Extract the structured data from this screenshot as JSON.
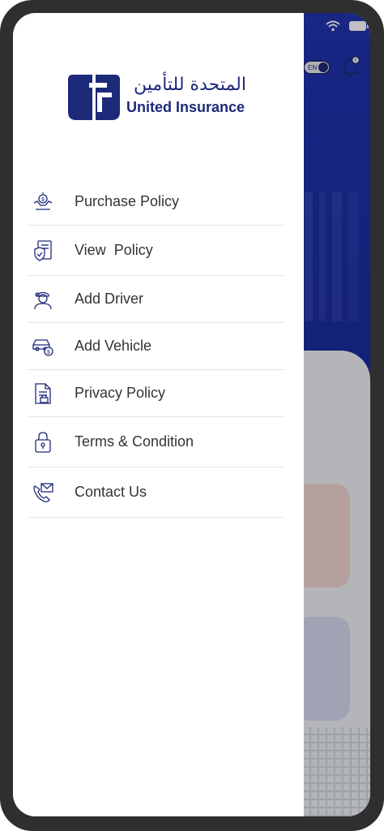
{
  "brand": {
    "name_ar": "المتحدة للتأمين",
    "name_en": "United Insurance",
    "color": "#1d2a7a"
  },
  "status_bar": {
    "icons": [
      "wifi-icon",
      "battery-icon"
    ]
  },
  "background": {
    "language_toggle": "EN",
    "header_color": "#1f32aa"
  },
  "drawer": {
    "items": [
      {
        "label": "Purchase Policy",
        "icon": "money-hand-icon"
      },
      {
        "label": "View  Policy",
        "icon": "policy-document-icon"
      },
      {
        "label": "Add Driver",
        "icon": "driver-icon"
      },
      {
        "label": "Add Vehicle",
        "icon": "vehicle-icon"
      },
      {
        "label": "Privacy Policy",
        "icon": "privacy-document-icon"
      },
      {
        "label": "Terms & Condition",
        "icon": "lock-icon"
      },
      {
        "label": "Contact Us",
        "icon": "phone-mail-icon"
      }
    ]
  }
}
